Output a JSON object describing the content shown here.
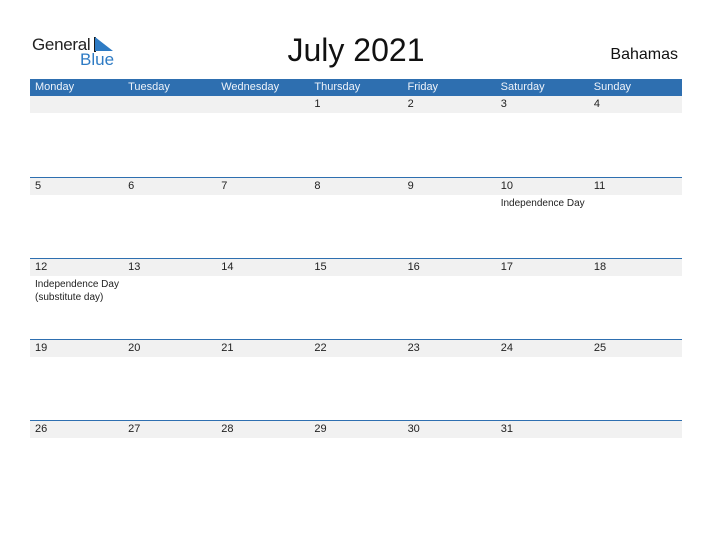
{
  "logo": {
    "word1": "General",
    "word2": "Blue"
  },
  "title": "July 2021",
  "country": "Bahamas",
  "colors": {
    "accent": "#2e6fb0",
    "band": "#f1f1f1",
    "logo_blue": "#2e7bc4"
  },
  "weekdays": [
    "Monday",
    "Tuesday",
    "Wednesday",
    "Thursday",
    "Friday",
    "Saturday",
    "Sunday"
  ],
  "weeks": [
    {
      "days": [
        {
          "n": ""
        },
        {
          "n": ""
        },
        {
          "n": ""
        },
        {
          "n": "1"
        },
        {
          "n": "2"
        },
        {
          "n": "3"
        },
        {
          "n": "4"
        }
      ]
    },
    {
      "days": [
        {
          "n": "5"
        },
        {
          "n": "6"
        },
        {
          "n": "7"
        },
        {
          "n": "8"
        },
        {
          "n": "9"
        },
        {
          "n": "10",
          "event": "Independence Day"
        },
        {
          "n": "11"
        }
      ]
    },
    {
      "days": [
        {
          "n": "12",
          "event": "Independence Day (substitute day)"
        },
        {
          "n": "13"
        },
        {
          "n": "14"
        },
        {
          "n": "15"
        },
        {
          "n": "16"
        },
        {
          "n": "17"
        },
        {
          "n": "18"
        }
      ]
    },
    {
      "days": [
        {
          "n": "19"
        },
        {
          "n": "20"
        },
        {
          "n": "21"
        },
        {
          "n": "22"
        },
        {
          "n": "23"
        },
        {
          "n": "24"
        },
        {
          "n": "25"
        }
      ]
    },
    {
      "days": [
        {
          "n": "26"
        },
        {
          "n": "27"
        },
        {
          "n": "28"
        },
        {
          "n": "29"
        },
        {
          "n": "30"
        },
        {
          "n": "31"
        },
        {
          "n": ""
        }
      ]
    }
  ]
}
